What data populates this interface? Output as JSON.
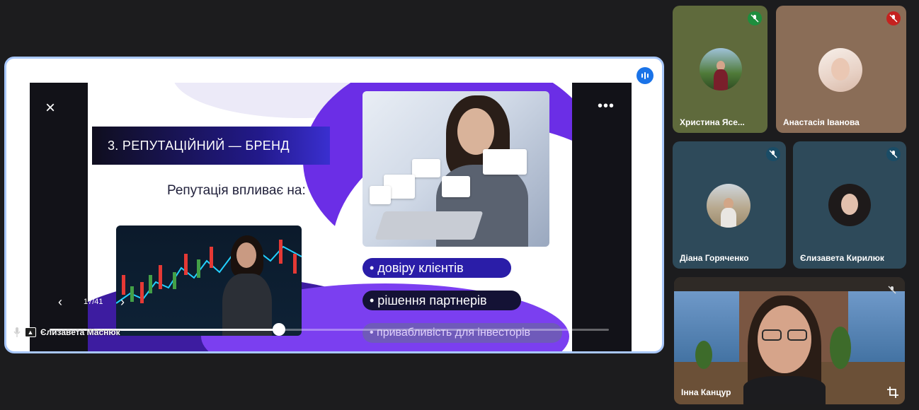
{
  "presentation": {
    "slide": {
      "title": "3. РЕПУТАЦІЙНИЙ — БРЕНД",
      "subtitle": "Репутація впливає на:",
      "bullets": [
        "• довіру клієнтів",
        "• рішення партнерів",
        "• привабливість для інвесторів"
      ]
    },
    "controls": {
      "close_icon": "×",
      "more_icon": "•••",
      "prev_icon": "‹",
      "next_icon": "›",
      "page_indicator": "17/41",
      "progress": 0.41
    },
    "presenter_name": "Єлизавета Маснюк"
  },
  "participants": [
    {
      "name": "Христина Ясе...",
      "muted": true,
      "bg": "#5f6a3c",
      "mute_badge": "#1e8e3e"
    },
    {
      "name": "Анастасія Іванова",
      "muted": true,
      "bg": "#8a6d57",
      "mute_badge": "#c5221f"
    },
    {
      "name": "Діана Горяченко",
      "muted": true,
      "bg": "#2e4a5a",
      "mute_badge": "#1a4c66"
    },
    {
      "name": "Єлизавета Кирилюк",
      "muted": true,
      "bg": "#2e4a5a",
      "mute_badge": "#1a4c66"
    },
    {
      "name": "Інна Канцур",
      "muted": true,
      "bg": "#3b3a38",
      "mute_badge": "#3b3a38"
    }
  ],
  "colors": {
    "accent_border": "#a8c7fa",
    "speaking_indicator": "#1a73e8",
    "slide_pill": "#2a1da8"
  }
}
